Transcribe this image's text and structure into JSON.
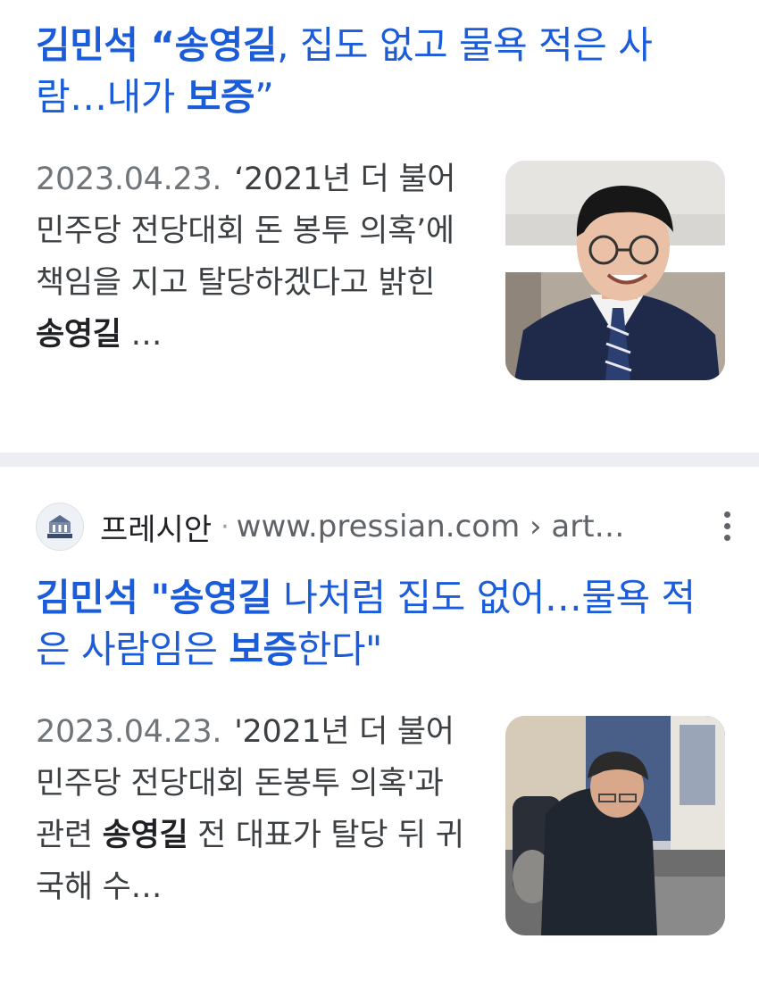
{
  "results": [
    {
      "headline_parts": [
        {
          "text": "김민석 ",
          "bold": true
        },
        {
          "text": "“송영길",
          "bold": true
        },
        {
          "text": ", 집도 없고 물욕 적은 사람…내가 ",
          "bold": false
        },
        {
          "text": "보증",
          "bold": true
        },
        {
          "text": "”",
          "bold": false
        }
      ],
      "date": "2023.04.23.",
      "snippet_parts": [
        {
          "text": "‘2021년 더 불어민주당 전당대회 돈 봉투 의혹’에 책임을 지고 탈당하겠다고 밝힌 ",
          "bold": false
        },
        {
          "text": "송영길",
          "bold": true
        },
        {
          "text": " …",
          "bold": false
        }
      ]
    },
    {
      "source": {
        "name": "프레시안",
        "separator": "·",
        "url": "www.pressian.com › art…",
        "favicon_label": "PRESSIAN"
      },
      "headline_parts": [
        {
          "text": "김민석 ",
          "bold": true
        },
        {
          "text": "\"송영길",
          "bold": true
        },
        {
          "text": " 나처럼 집도 없어…물욕 적은 사람임은 ",
          "bold": false
        },
        {
          "text": "보증",
          "bold": true
        },
        {
          "text": "한다\"",
          "bold": false
        }
      ],
      "date": "2023.04.23.",
      "snippet_parts": [
        {
          "text": "'2021년 더 불어민주당 전당대회 돈봉투 의혹'과 관련 ",
          "bold": false
        },
        {
          "text": "송영길",
          "bold": true
        },
        {
          "text": " 전 대표가 탈당 뒤 귀국해 수…",
          "bold": false
        }
      ]
    }
  ],
  "colors": {
    "headline": "#1a5cd9",
    "snippet": "#3c4043",
    "date": "#70757a",
    "divider": "#eceef1"
  }
}
